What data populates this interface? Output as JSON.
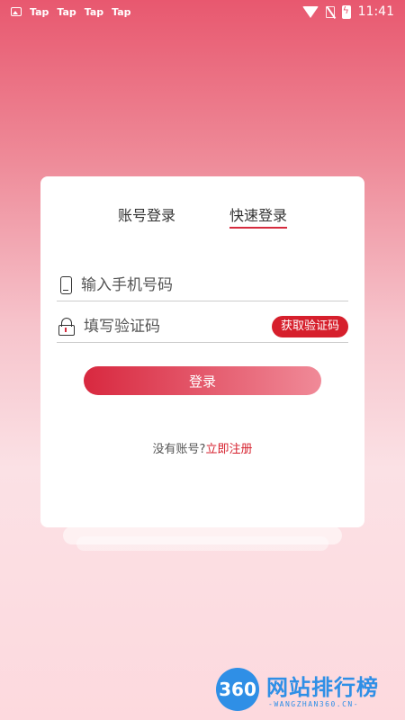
{
  "status_bar": {
    "tap_labels": [
      "Tap",
      "Tap",
      "Tap",
      "Tap"
    ],
    "time": "11:41"
  },
  "tabs": {
    "account_login": "账号登录",
    "quick_login": "快速登录",
    "active": "quick_login"
  },
  "form": {
    "phone_placeholder": "输入手机号码",
    "code_placeholder": "填写验证码",
    "get_code_label": "获取验证码",
    "login_label": "登录"
  },
  "footer": {
    "no_account_text": "没有账号?",
    "register_link": "立即注册"
  },
  "watermark": {
    "logo_text": "360",
    "title": "网站排行榜",
    "subtitle": "-WANGZHAN360.CN-"
  },
  "colors": {
    "accent": "#d61f2c",
    "watermark": "#2f8fe6"
  }
}
